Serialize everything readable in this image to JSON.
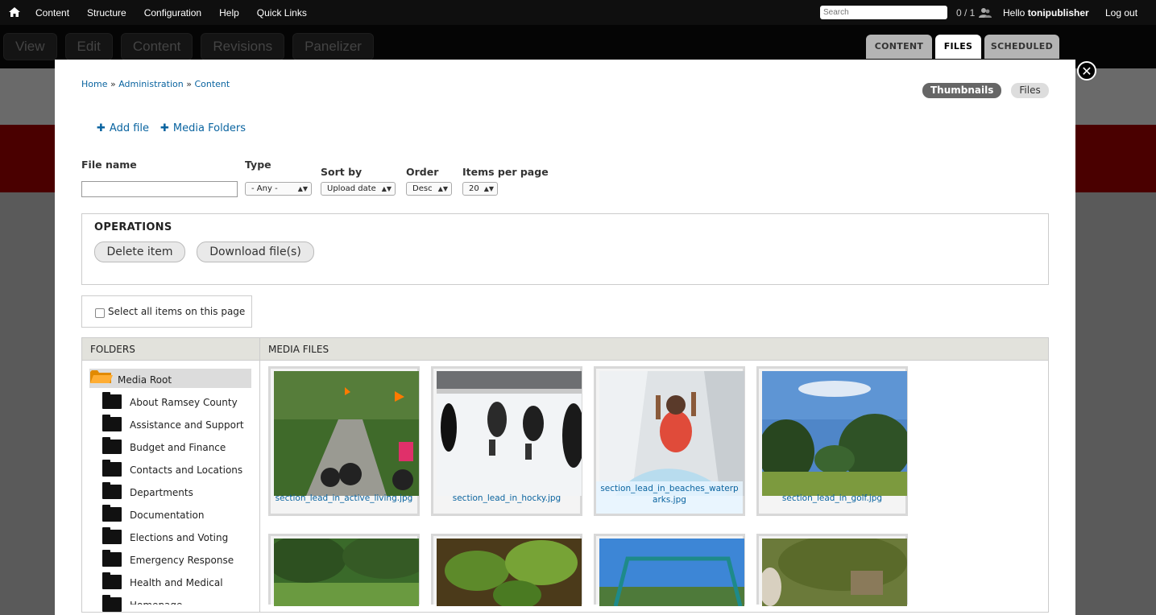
{
  "toolbar": {
    "nav": [
      "Content",
      "Structure",
      "Configuration",
      "Help",
      "Quick Links"
    ],
    "search_placeholder": "Search",
    "counter": "0 / 1",
    "hello_prefix": "Hello ",
    "username": "tonipublisher",
    "logout": "Log out"
  },
  "page_tabs": [
    "View",
    "Edit",
    "Content",
    "Revisions",
    "Panelizer"
  ],
  "panel_tabs": {
    "content": "CONTENT",
    "files": "FILES",
    "scheduled": "SCHEDULED"
  },
  "breadcrumb": {
    "home": "Home",
    "admin": "Administration",
    "content": "Content",
    "sep": "»"
  },
  "view_toggle": {
    "thumbnails": "Thumbnails",
    "files": "Files"
  },
  "actions": {
    "add_file": "Add file",
    "media_folders": "Media Folders",
    "plus": "✚"
  },
  "filters": {
    "file_name_label": "File name",
    "file_name_value": "",
    "type_label": "Type",
    "type_value": "- Any -",
    "sort_label": "Sort by",
    "sort_value": "Upload date",
    "order_label": "Order",
    "order_value": "Desc",
    "items_label": "Items per page",
    "items_value": "20"
  },
  "operations": {
    "title": "OPERATIONS",
    "delete": "Delete item",
    "download": "Download file(s)"
  },
  "select_all": "Select all items on this page",
  "folders": {
    "header": "FOLDERS",
    "root": "Media Root",
    "items": [
      "About Ramsey County",
      "Assistance and Support",
      "Budget and Finance",
      "Contacts and Locations",
      "Departments",
      "Documentation",
      "Elections and Voting",
      "Emergency Response",
      "Health and Medical",
      "Homepage"
    ]
  },
  "media": {
    "header": "MEDIA FILES",
    "files": [
      {
        "line1": "section_lead_in_active_living.jpg",
        "line2": ""
      },
      {
        "line1": "section_lead_in_hocky.jpg",
        "line2": ""
      },
      {
        "line1": "section_lead_in_beaches_waterp",
        "line2": "arks.jpg"
      },
      {
        "line1": "section_lead_in_golf.jpg",
        "line2": ""
      }
    ]
  },
  "close_glyph": "✕"
}
